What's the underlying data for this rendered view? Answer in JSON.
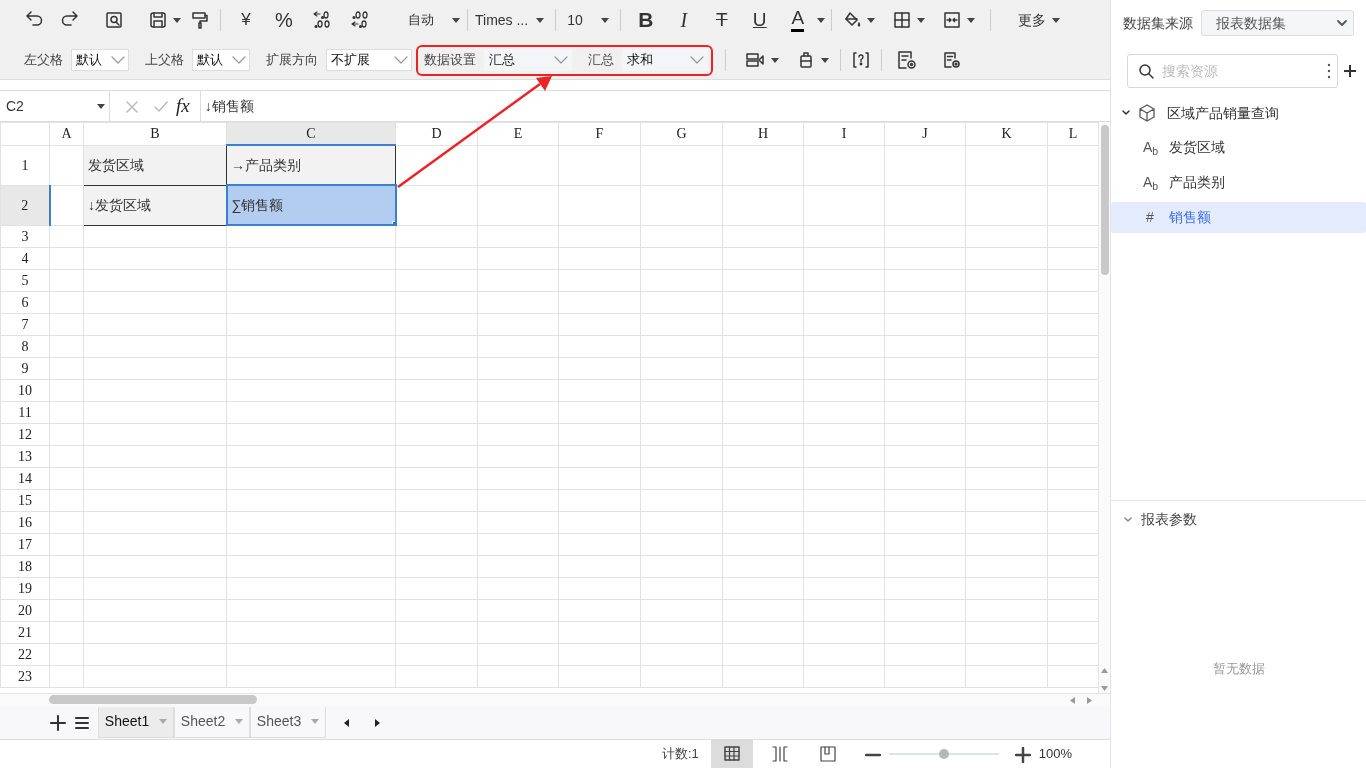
{
  "toolbar": {
    "text_buttons": [
      {
        "kind": "currency",
        "glyph": "¥"
      },
      {
        "kind": "percent",
        "glyph": "%"
      }
    ],
    "format_select": "自动",
    "font_select": "Times ...",
    "size_select": "10",
    "style_buttons": [
      {
        "kind": "bold",
        "glyph": "B"
      },
      {
        "kind": "italic",
        "glyph": "I"
      },
      {
        "kind": "strike",
        "glyph": "T"
      },
      {
        "kind": "underline",
        "glyph": "U"
      },
      {
        "kind": "font_color",
        "glyph": "A"
      }
    ],
    "more_menu": "更多"
  },
  "cell_settings": [
    {
      "label": "左父格",
      "value": "默认"
    },
    {
      "label": "上父格",
      "value": "默认"
    },
    {
      "label": "扩展方向",
      "value": "不扩展"
    }
  ],
  "data_settings": [
    {
      "label": "数据设置",
      "value": "汇总"
    },
    {
      "label": "汇总",
      "value": "求和"
    }
  ],
  "formula_bar": {
    "name_box": "C2",
    "fx": "fx",
    "formula": "↓销售额"
  },
  "sheet": {
    "columns": [
      {
        "label": "A",
        "selected": false
      },
      {
        "label": "B",
        "selected": false
      },
      {
        "label": "C",
        "selected": true
      },
      {
        "label": "D",
        "selected": false
      },
      {
        "label": "E",
        "selected": false
      },
      {
        "label": "F",
        "selected": false
      },
      {
        "label": "G",
        "selected": false
      },
      {
        "label": "H",
        "selected": false
      },
      {
        "label": "I",
        "selected": false
      },
      {
        "label": "J",
        "selected": false
      },
      {
        "label": "K",
        "selected": false
      },
      {
        "label": "L",
        "selected": false
      }
    ],
    "rows": [
      {
        "header": "1",
        "selected": false,
        "cells": [
          {
            "text": "发货区域",
            "selected": false
          },
          {
            "text": "→产品类别",
            "selected": false
          }
        ]
      },
      {
        "header": "2",
        "selected": true,
        "cells": [
          {
            "text": "↓发货区域",
            "selected": false
          },
          {
            "text": "∑销售额",
            "selected": true
          }
        ]
      },
      {
        "header": "3",
        "selected": false
      },
      {
        "header": "4",
        "selected": false
      },
      {
        "header": "5",
        "selected": false
      },
      {
        "header": "6",
        "selected": false
      },
      {
        "header": "7",
        "selected": false
      },
      {
        "header": "8",
        "selected": false
      },
      {
        "header": "9",
        "selected": false
      },
      {
        "header": "10",
        "selected": false
      },
      {
        "header": "11",
        "selected": false
      },
      {
        "header": "12",
        "selected": false
      },
      {
        "header": "13",
        "selected": false
      },
      {
        "header": "14",
        "selected": false
      },
      {
        "header": "15",
        "selected": false
      },
      {
        "header": "16",
        "selected": false
      },
      {
        "header": "17",
        "selected": false
      },
      {
        "header": "18",
        "selected": false
      },
      {
        "header": "19",
        "selected": false
      },
      {
        "header": "20",
        "selected": false
      },
      {
        "header": "21",
        "selected": false
      },
      {
        "header": "22",
        "selected": false
      },
      {
        "header": "23",
        "selected": false
      }
    ]
  },
  "sheet_tabs": [
    {
      "label": "Sheet1",
      "selected": true
    },
    {
      "label": "Sheet2",
      "selected": false
    },
    {
      "label": "Sheet3",
      "selected": false
    }
  ],
  "status_bar": {
    "count": "计数:1",
    "view_modes": [
      {
        "selected": true
      },
      {
        "selected": false
      },
      {
        "selected": false
      }
    ],
    "zoom": {
      "level": 0.5
    },
    "zoom_reading": "100%"
  },
  "right_panel": {
    "source_label": "数据集来源",
    "source_select": "报表数据集",
    "search": {
      "placeholder": "搜索资源"
    },
    "dataset": {
      "label": "区域产品销量查询",
      "expanded": true,
      "children": [
        {
          "label": "发货区域",
          "type_glyph": "A$_{b}$",
          "selected": false
        },
        {
          "label": "产品类别",
          "type_glyph": "A$_{b}$",
          "selected": false
        },
        {
          "label": "销售额",
          "type_glyph": "#",
          "selected": true
        }
      ]
    },
    "params": {
      "label": "报表参数",
      "expanded": true,
      "empty_text": "暂无数据"
    }
  }
}
